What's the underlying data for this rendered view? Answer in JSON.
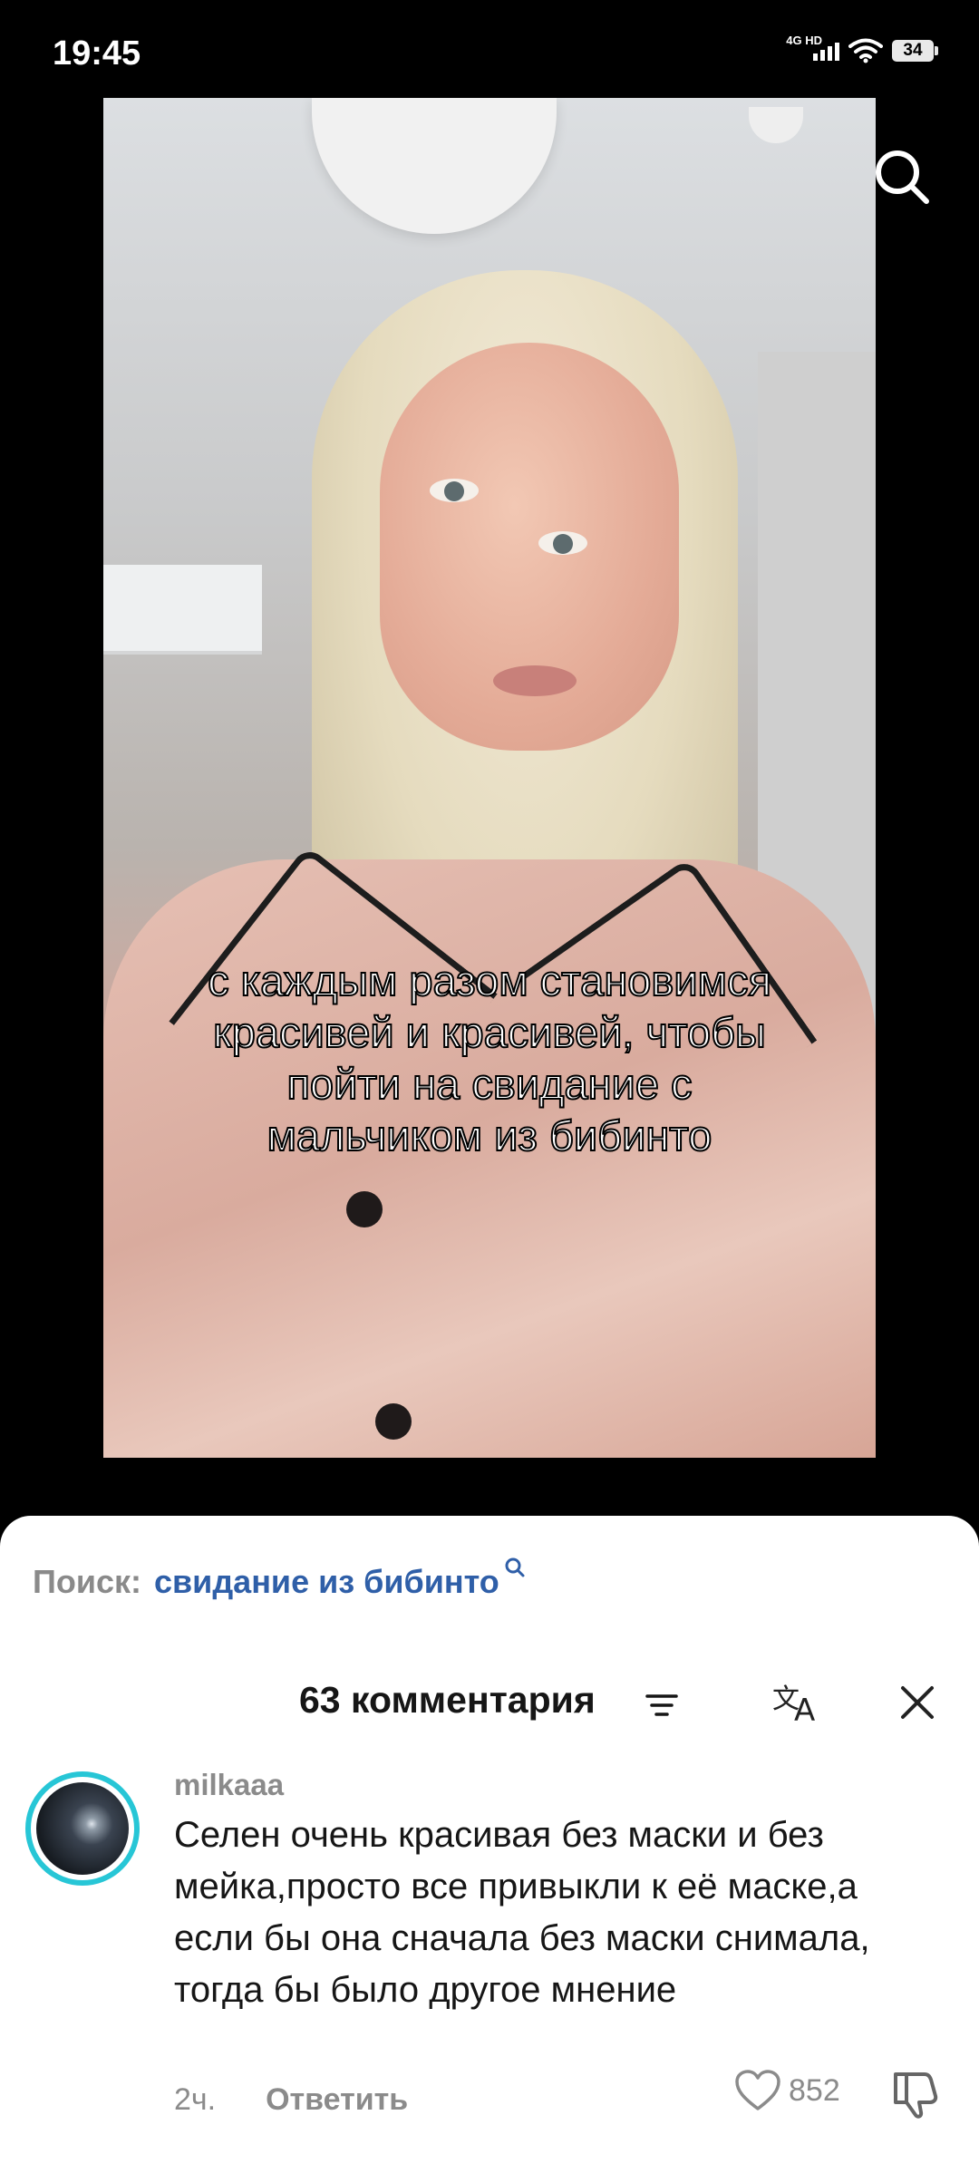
{
  "status_bar": {
    "time": "19:45",
    "network": "4G HD",
    "battery": "34"
  },
  "video": {
    "caption_lines": [
      "с каждым разом становимся",
      "красивей и красивей, чтобы",
      "пойти на свидание с",
      "мальчиком из бибинто"
    ]
  },
  "search": {
    "label": "Поиск:",
    "query": "свидание из бибинто"
  },
  "comments": {
    "count_label": "63 комментария",
    "items": [
      {
        "username": "milkaaa",
        "text": "Селен очень красивая без маски и без мейка,просто все привыкли к её маске,а если бы она сначала без маски снимала, тогда бы было другое мнение",
        "time": "2ч.",
        "reply_label": "Ответить",
        "likes": "852"
      }
    ]
  },
  "colors": {
    "search_query": "#2f5fa8",
    "avatar_ring": "#27c6d6",
    "muted_text": "#8b8b8b"
  }
}
